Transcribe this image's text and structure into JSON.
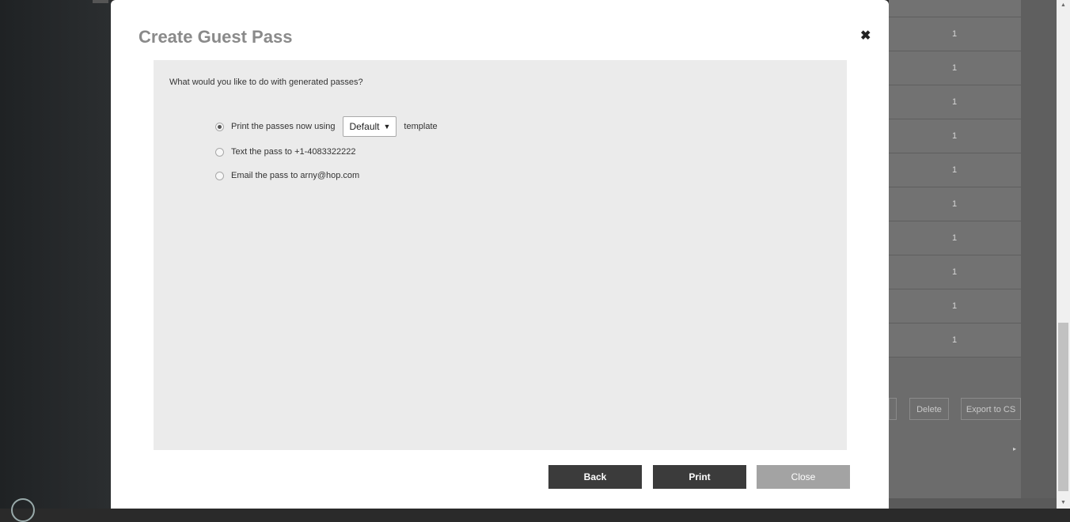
{
  "dialog": {
    "title": "Create Guest Pass",
    "close_glyph": "✖",
    "question": "What would you like to do with generated passes?",
    "options": [
      {
        "label": "Print the passes now using",
        "selected": true
      },
      {
        "label": "Text the pass to +1-4083322222",
        "selected": false
      },
      {
        "label": "Email the pass to arny@hop.com",
        "selected": false
      }
    ],
    "template_select": {
      "value": "Default",
      "caret": "▼",
      "suffix": "template"
    },
    "buttons": {
      "back": "Back",
      "print": "Print",
      "close": "Close"
    }
  },
  "background_table": {
    "rows": [
      "1",
      "1",
      "1",
      "1",
      "1",
      "1",
      "1",
      "1",
      "1",
      "1"
    ],
    "delete_label": "Delete",
    "export_label": "Export to CS",
    "caret": "▸"
  },
  "scrollbar": {
    "up": "▲",
    "down": "▼"
  }
}
